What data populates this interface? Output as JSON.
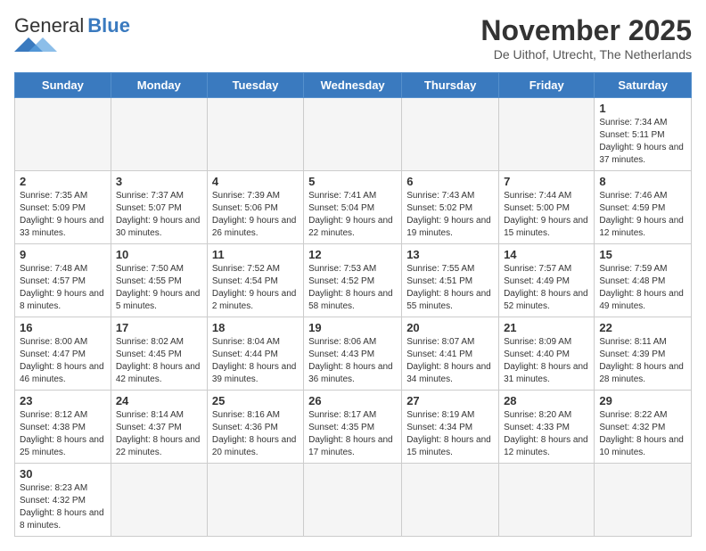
{
  "logo": {
    "general": "General",
    "blue": "Blue"
  },
  "header": {
    "month": "November 2025",
    "location": "De Uithof, Utrecht, The Netherlands"
  },
  "days_of_week": [
    "Sunday",
    "Monday",
    "Tuesday",
    "Wednesday",
    "Thursday",
    "Friday",
    "Saturday"
  ],
  "weeks": [
    [
      {
        "day": "",
        "info": ""
      },
      {
        "day": "",
        "info": ""
      },
      {
        "day": "",
        "info": ""
      },
      {
        "day": "",
        "info": ""
      },
      {
        "day": "",
        "info": ""
      },
      {
        "day": "",
        "info": ""
      },
      {
        "day": "1",
        "info": "Sunrise: 7:34 AM\nSunset: 5:11 PM\nDaylight: 9 hours and 37 minutes."
      }
    ],
    [
      {
        "day": "2",
        "info": "Sunrise: 7:35 AM\nSunset: 5:09 PM\nDaylight: 9 hours and 33 minutes."
      },
      {
        "day": "3",
        "info": "Sunrise: 7:37 AM\nSunset: 5:07 PM\nDaylight: 9 hours and 30 minutes."
      },
      {
        "day": "4",
        "info": "Sunrise: 7:39 AM\nSunset: 5:06 PM\nDaylight: 9 hours and 26 minutes."
      },
      {
        "day": "5",
        "info": "Sunrise: 7:41 AM\nSunset: 5:04 PM\nDaylight: 9 hours and 22 minutes."
      },
      {
        "day": "6",
        "info": "Sunrise: 7:43 AM\nSunset: 5:02 PM\nDaylight: 9 hours and 19 minutes."
      },
      {
        "day": "7",
        "info": "Sunrise: 7:44 AM\nSunset: 5:00 PM\nDaylight: 9 hours and 15 minutes."
      },
      {
        "day": "8",
        "info": "Sunrise: 7:46 AM\nSunset: 4:59 PM\nDaylight: 9 hours and 12 minutes."
      }
    ],
    [
      {
        "day": "9",
        "info": "Sunrise: 7:48 AM\nSunset: 4:57 PM\nDaylight: 9 hours and 8 minutes."
      },
      {
        "day": "10",
        "info": "Sunrise: 7:50 AM\nSunset: 4:55 PM\nDaylight: 9 hours and 5 minutes."
      },
      {
        "day": "11",
        "info": "Sunrise: 7:52 AM\nSunset: 4:54 PM\nDaylight: 9 hours and 2 minutes."
      },
      {
        "day": "12",
        "info": "Sunrise: 7:53 AM\nSunset: 4:52 PM\nDaylight: 8 hours and 58 minutes."
      },
      {
        "day": "13",
        "info": "Sunrise: 7:55 AM\nSunset: 4:51 PM\nDaylight: 8 hours and 55 minutes."
      },
      {
        "day": "14",
        "info": "Sunrise: 7:57 AM\nSunset: 4:49 PM\nDaylight: 8 hours and 52 minutes."
      },
      {
        "day": "15",
        "info": "Sunrise: 7:59 AM\nSunset: 4:48 PM\nDaylight: 8 hours and 49 minutes."
      }
    ],
    [
      {
        "day": "16",
        "info": "Sunrise: 8:00 AM\nSunset: 4:47 PM\nDaylight: 8 hours and 46 minutes."
      },
      {
        "day": "17",
        "info": "Sunrise: 8:02 AM\nSunset: 4:45 PM\nDaylight: 8 hours and 42 minutes."
      },
      {
        "day": "18",
        "info": "Sunrise: 8:04 AM\nSunset: 4:44 PM\nDaylight: 8 hours and 39 minutes."
      },
      {
        "day": "19",
        "info": "Sunrise: 8:06 AM\nSunset: 4:43 PM\nDaylight: 8 hours and 36 minutes."
      },
      {
        "day": "20",
        "info": "Sunrise: 8:07 AM\nSunset: 4:41 PM\nDaylight: 8 hours and 34 minutes."
      },
      {
        "day": "21",
        "info": "Sunrise: 8:09 AM\nSunset: 4:40 PM\nDaylight: 8 hours and 31 minutes."
      },
      {
        "day": "22",
        "info": "Sunrise: 8:11 AM\nSunset: 4:39 PM\nDaylight: 8 hours and 28 minutes."
      }
    ],
    [
      {
        "day": "23",
        "info": "Sunrise: 8:12 AM\nSunset: 4:38 PM\nDaylight: 8 hours and 25 minutes."
      },
      {
        "day": "24",
        "info": "Sunrise: 8:14 AM\nSunset: 4:37 PM\nDaylight: 8 hours and 22 minutes."
      },
      {
        "day": "25",
        "info": "Sunrise: 8:16 AM\nSunset: 4:36 PM\nDaylight: 8 hours and 20 minutes."
      },
      {
        "day": "26",
        "info": "Sunrise: 8:17 AM\nSunset: 4:35 PM\nDaylight: 8 hours and 17 minutes."
      },
      {
        "day": "27",
        "info": "Sunrise: 8:19 AM\nSunset: 4:34 PM\nDaylight: 8 hours and 15 minutes."
      },
      {
        "day": "28",
        "info": "Sunrise: 8:20 AM\nSunset: 4:33 PM\nDaylight: 8 hours and 12 minutes."
      },
      {
        "day": "29",
        "info": "Sunrise: 8:22 AM\nSunset: 4:32 PM\nDaylight: 8 hours and 10 minutes."
      }
    ],
    [
      {
        "day": "30",
        "info": "Sunrise: 8:23 AM\nSunset: 4:32 PM\nDaylight: 8 hours and 8 minutes."
      },
      {
        "day": "",
        "info": ""
      },
      {
        "day": "",
        "info": ""
      },
      {
        "day": "",
        "info": ""
      },
      {
        "day": "",
        "info": ""
      },
      {
        "day": "",
        "info": ""
      },
      {
        "day": "",
        "info": ""
      }
    ]
  ]
}
